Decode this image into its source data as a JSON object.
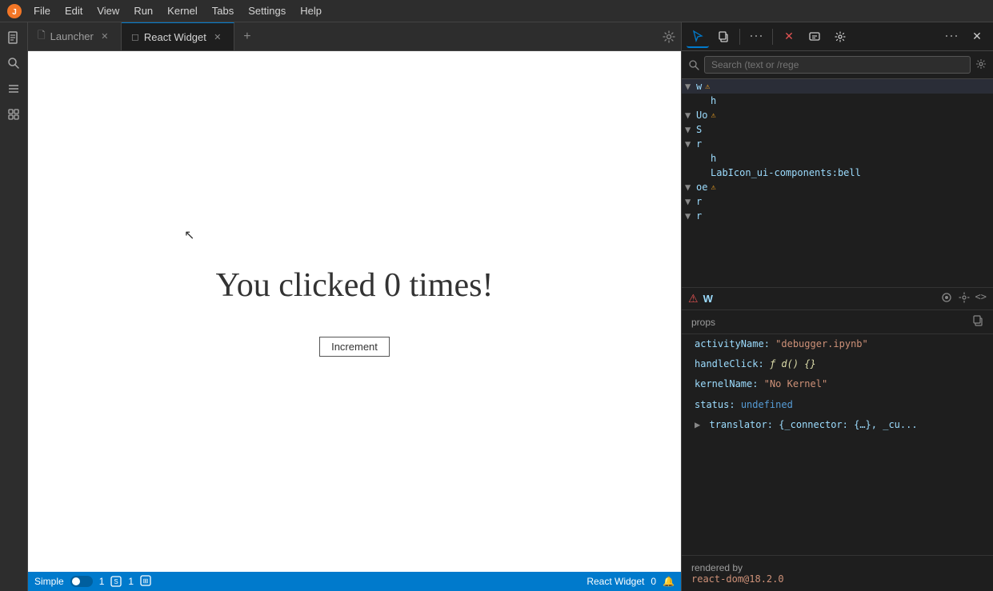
{
  "menu": {
    "items": [
      "File",
      "Edit",
      "View",
      "Run",
      "Kernel",
      "Tabs",
      "Settings",
      "Help"
    ]
  },
  "sidebar": {
    "icons": [
      "🗋",
      "◎",
      "☰",
      "⧉"
    ]
  },
  "tabs": {
    "launcher": {
      "label": "Launcher",
      "icon": "🗋"
    },
    "react_widget": {
      "label": "React Widget",
      "icon": "◻"
    },
    "add": "+"
  },
  "widget": {
    "click_text": "You clicked 0 times!",
    "button_label": "Increment"
  },
  "status_bar": {
    "mode": "Simple",
    "branch": "1",
    "widget_name": "React Widget",
    "count": "0"
  },
  "debugger": {
    "toolbar": {
      "cursor_btn": "↖",
      "copy_btn": "⧉",
      "more_btn": "⋯",
      "close_btn": "✕",
      "message_btn": "☐",
      "settings_btn": "⚙",
      "overflow_btn": "⋯",
      "active_tab": "cursor"
    },
    "search": {
      "placeholder": "Search (text or /rege",
      "gear_label": "⚙"
    },
    "tree": [
      {
        "indent": 0,
        "arrow": "▼",
        "label": "w",
        "warn": true,
        "selected": true
      },
      {
        "indent": 1,
        "arrow": "",
        "label": "h",
        "warn": false
      },
      {
        "indent": 0,
        "arrow": "▼",
        "label": "Uo",
        "warn": true
      },
      {
        "indent": 0,
        "arrow": "▼",
        "label": "S",
        "warn": false
      },
      {
        "indent": 0,
        "arrow": "▼",
        "label": "r",
        "warn": false
      },
      {
        "indent": 1,
        "arrow": "",
        "label": "h",
        "warn": false
      },
      {
        "indent": 1,
        "arrow": "",
        "label": "LabIcon_ui-components:bell",
        "warn": false
      },
      {
        "indent": 0,
        "arrow": "▼",
        "label": "oe",
        "warn": true
      },
      {
        "indent": 0,
        "arrow": "▼",
        "label": "r",
        "warn": false
      },
      {
        "indent": 0,
        "arrow": "▼",
        "label": "r",
        "warn": false
      }
    ],
    "selected_node": {
      "warn_icon": "⚠",
      "label": "W",
      "actions": [
        "👁",
        "⚙",
        "<>"
      ]
    },
    "props": {
      "header": "props",
      "items": [
        {
          "key": "activityName:",
          "value": "\"debugger.ipynb\"",
          "type": "string"
        },
        {
          "key": "handleClick:",
          "value": "ƒ d() {}",
          "type": "func"
        },
        {
          "key": "kernelName:",
          "value": "\"No Kernel\"",
          "type": "string"
        },
        {
          "key": "status:",
          "value": "undefined",
          "type": "undef"
        },
        {
          "key": "translator:",
          "value": "{_connector: {…}, _cu...",
          "type": "obj",
          "expandable": true
        }
      ]
    },
    "rendered_by": {
      "label": "rendered by",
      "value": "react-dom@18.2.0"
    }
  }
}
